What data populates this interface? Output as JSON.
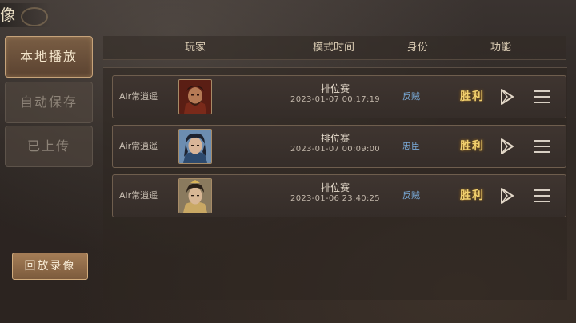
{
  "window_title_fragment": "像",
  "tabs": [
    {
      "label": "本地播放",
      "active": true
    },
    {
      "label": "自动保存",
      "active": false
    },
    {
      "label": "已上传",
      "active": false
    }
  ],
  "replay_button": "回放录像",
  "columns": {
    "player": "玩家",
    "mode_time": "模式时间",
    "role": "身份",
    "actions": "功能"
  },
  "records": [
    {
      "player": "Air常逍遥",
      "avatar": "warrior-red-portrait",
      "mode": "排位赛",
      "time": "2023-01-07  00:17:19",
      "role": "反贼",
      "result": "胜利"
    },
    {
      "player": "Air常逍遥",
      "avatar": "warrior-blue-portrait",
      "mode": "排位赛",
      "time": "2023-01-07  00:09:00",
      "role": "忠臣",
      "result": "胜利"
    },
    {
      "player": "Air常逍遥",
      "avatar": "warrior-gold-portrait",
      "mode": "排位赛",
      "time": "2023-01-06  23:40:25",
      "role": "反贼",
      "result": "胜利"
    }
  ],
  "colors": {
    "accent": "#c6a37a",
    "role_text": "#79a9d6",
    "victory": "#f0cf6e"
  }
}
